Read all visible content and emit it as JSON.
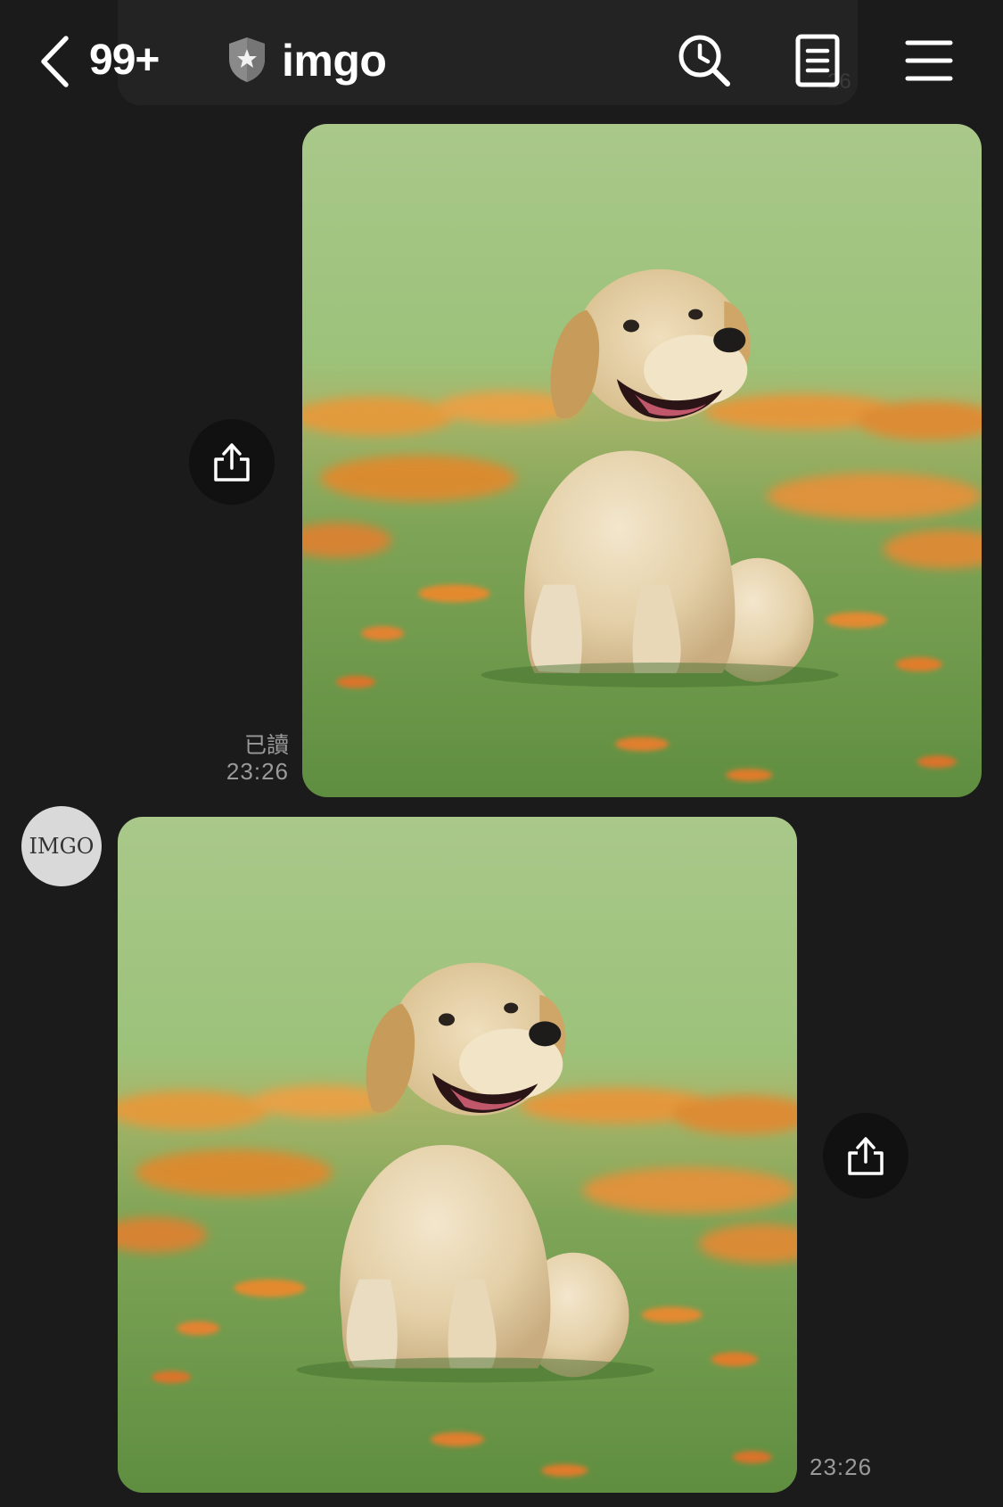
{
  "header": {
    "unread_count": "99+",
    "title": "imgo",
    "back_icon": "chevron-left-icon",
    "badge_icon": "shield-star-icon",
    "history_icon": "clock-search-icon",
    "notes_icon": "note-icon",
    "menu_icon": "hamburger-menu-icon"
  },
  "background_hint": {
    "partial_time": "26"
  },
  "messages": [
    {
      "direction": "sent",
      "type": "image",
      "image_subject": "golden retriever puppy sitting in grass with orange flowers",
      "read_receipt": "已讀",
      "time": "23:26",
      "share_icon": "share-icon"
    },
    {
      "direction": "received",
      "type": "image",
      "sender_avatar_text": "IMGO",
      "image_subject": "golden retriever puppy sitting in grass with orange flowers",
      "time": "23:26",
      "share_icon": "share-icon"
    }
  ],
  "colors": {
    "background": "#1b1b1b",
    "secondary_text": "#9a9a9a",
    "share_button_bg": "#111111",
    "avatar_bg": "#d9d9d9"
  }
}
